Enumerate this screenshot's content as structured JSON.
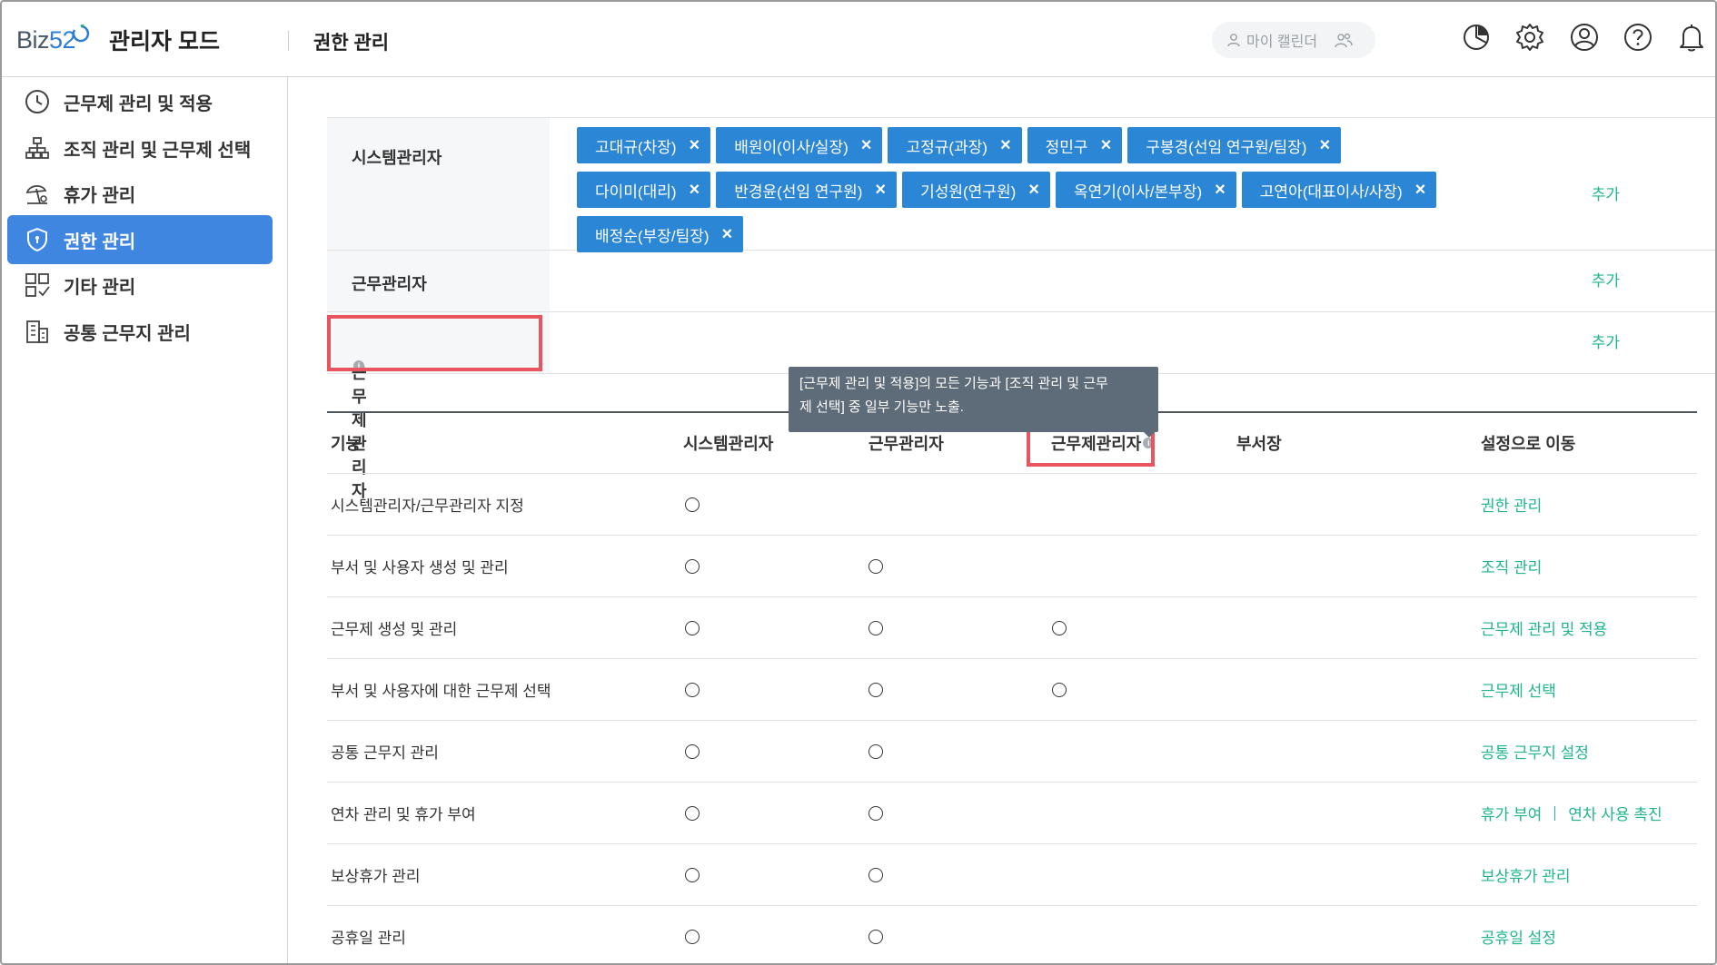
{
  "header": {
    "logo_text": "Biz",
    "logo_num": "52",
    "mode_title": "관리자 모드",
    "page_title": "권한 관리",
    "my_calendar": "마이 캘린더",
    "icons": [
      "report-icon",
      "gear-icon",
      "user-icon",
      "help-icon",
      "bell-icon"
    ]
  },
  "sidebar": {
    "items": [
      {
        "label": "근무제 관리 및 적용",
        "icon": "clock-icon",
        "active": false
      },
      {
        "label": "조직 관리 및 근무제 선택",
        "icon": "org-chart-icon",
        "active": false
      },
      {
        "label": "휴가 관리",
        "icon": "vacation-icon",
        "active": false
      },
      {
        "label": "권한 관리",
        "icon": "shield-icon",
        "active": true
      },
      {
        "label": "기타 관리",
        "icon": "grid-icon",
        "active": false
      },
      {
        "label": "공통 근무지 관리",
        "icon": "building-icon",
        "active": false
      }
    ]
  },
  "roles": {
    "sys_admin": {
      "label": "시스템관리자",
      "members": [
        "고대규(차장)",
        "배원이(이사/실장)",
        "고정규(과장)",
        "정민구",
        "구봉경(선임 연구원/팀장)",
        "다이미(대리)",
        "반경윤(선임 연구원)",
        "기성원(연구원)",
        "옥연기(이사/본부장)",
        "고연아(대표이사/사장)",
        "배정순(부장/팀장)"
      ],
      "add": "추가"
    },
    "work_admin": {
      "label": "근무관리자",
      "add": "추가"
    },
    "worksys_admin": {
      "label": "근무제관리자",
      "add": "추가"
    }
  },
  "tooltip": {
    "line1": "[근무제 관리 및 적용]의 모든 기능과 [조직 관리 및 근무",
    "line2": "제 선택] 중 일부 기능만 노출."
  },
  "function_table": {
    "headers": {
      "function": "기능",
      "sys_admin": "시스템관리자",
      "work_admin": "근무관리자",
      "worksys_admin": "근무제관리자",
      "dept_head": "부서장",
      "goto": "설정으로 이동"
    },
    "rows": [
      {
        "function": "시스템관리자/근무관리자 지정",
        "sys": true,
        "work": false,
        "wsys": false,
        "links": [
          "권한 관리"
        ]
      },
      {
        "function": "부서 및 사용자 생성 및 관리",
        "sys": true,
        "work": true,
        "wsys": false,
        "links": [
          "조직 관리"
        ]
      },
      {
        "function": "근무제 생성 및 관리",
        "sys": true,
        "work": true,
        "wsys": true,
        "links": [
          "근무제 관리 및 적용"
        ]
      },
      {
        "function": "부서 및 사용자에 대한 근무제 선택",
        "sys": true,
        "work": true,
        "wsys": true,
        "links": [
          "근무제 선택"
        ]
      },
      {
        "function": "공통 근무지 관리",
        "sys": true,
        "work": true,
        "wsys": false,
        "links": [
          "공통 근무지 설정"
        ]
      },
      {
        "function": "연차 관리 및 휴가 부여",
        "sys": true,
        "work": true,
        "wsys": false,
        "links": [
          "휴가 부여",
          "연차 사용 촉진"
        ]
      },
      {
        "function": "보상휴가 관리",
        "sys": true,
        "work": true,
        "wsys": false,
        "links": [
          "보상휴가 관리"
        ]
      },
      {
        "function": "공휴일 관리",
        "sys": true,
        "work": true,
        "wsys": false,
        "links": [
          "공휴일 설정"
        ]
      }
    ]
  },
  "colors": {
    "accent": "#3f86e0",
    "chip": "#2c86d6",
    "link": "#1fb58d",
    "highlight": "#e8555e",
    "tooltip": "#5e6b78"
  }
}
